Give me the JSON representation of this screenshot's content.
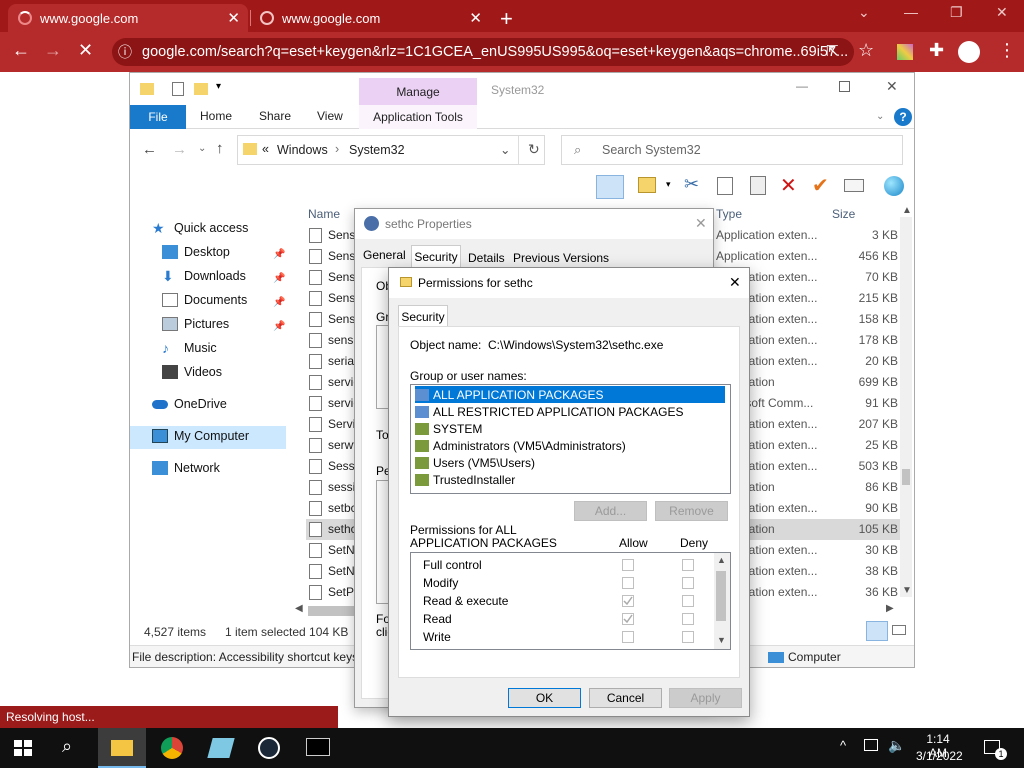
{
  "browser": {
    "tabs": [
      {
        "label": "www.google.com"
      },
      {
        "label": "www.google.com"
      }
    ],
    "url": "google.com/search?q=eset+keygen&rlz=1C1GCEA_enUS995US995&oq=eset+keygen&aqs=chrome..69i57..."
  },
  "explorer": {
    "title": "System32",
    "ribbon": {
      "file": "File",
      "home": "Home",
      "share": "Share",
      "view": "View",
      "manage": "Manage",
      "app_tools": "Application Tools"
    },
    "breadcrumb": {
      "prefix": "«",
      "parent": "Windows",
      "current": "System32"
    },
    "search_placeholder": "Search System32",
    "nav": [
      {
        "label": "Quick access"
      },
      {
        "label": "Desktop"
      },
      {
        "label": "Downloads"
      },
      {
        "label": "Documents"
      },
      {
        "label": "Pictures"
      },
      {
        "label": "Music"
      },
      {
        "label": "Videos"
      },
      {
        "label": "OneDrive"
      },
      {
        "label": "My Computer"
      },
      {
        "label": "Network"
      }
    ],
    "columns": {
      "name": "Name",
      "type": "Type",
      "size": "Size"
    },
    "files": [
      {
        "name": "Sensor",
        "type": "Application exten...",
        "size": "3 KB"
      },
      {
        "name": "Sensor",
        "type": "Application exten...",
        "size": "456 KB"
      },
      {
        "name": "Sensor",
        "type": "Application exten...",
        "size": "70 KB"
      },
      {
        "name": "Sensor",
        "type": "Application exten...",
        "size": "215 KB"
      },
      {
        "name": "Sensor",
        "type": "Application exten...",
        "size": "158 KB"
      },
      {
        "name": "sensrs",
        "type": "Application exten...",
        "size": "178 KB"
      },
      {
        "name": "serial",
        "type": "Application exten...",
        "size": "20 KB"
      },
      {
        "name": "servic",
        "type": "Application",
        "size": "699 KB"
      },
      {
        "name": "servic",
        "type": "Microsoft Comm...",
        "size": "91 KB"
      },
      {
        "name": "Servic",
        "type": "Application exten...",
        "size": "207 KB"
      },
      {
        "name": "serwv",
        "type": "Application exten...",
        "size": "25 KB"
      },
      {
        "name": "SessE",
        "type": "Application exten...",
        "size": "503 KB"
      },
      {
        "name": "sessio",
        "type": "Application",
        "size": "86 KB"
      },
      {
        "name": "setbc",
        "type": "Application exten...",
        "size": "90 KB"
      },
      {
        "name": "sethc",
        "type": "Application",
        "size": "105 KB"
      },
      {
        "name": "SetNe",
        "type": "Application exten...",
        "size": "30 KB"
      },
      {
        "name": "SetNe",
        "type": "Application exten...",
        "size": "38 KB"
      },
      {
        "name": "SetPr",
        "type": "Application exten...",
        "size": "36 KB"
      }
    ],
    "status": {
      "items": "4,527 items",
      "selected": "1 item selected  104 KB"
    },
    "details_bar": {
      "description": "File description: Accessibility shortcut keys",
      "location": "Computer"
    }
  },
  "props_dialog": {
    "title": "sethc Properties",
    "tabs": [
      "General",
      "Security",
      "Details",
      "Previous Versions"
    ],
    "snippets": {
      "ob": "Ob",
      "gr": "Gr",
      "to": "To",
      "pe": "Pe",
      "fo": "Fo",
      "cli": "clic"
    }
  },
  "perm_dialog": {
    "title": "Permissions for sethc",
    "tab": "Security",
    "object_label": "Object name:",
    "object_value": "C:\\Windows\\System32\\sethc.exe",
    "group_label": "Group or user names:",
    "users": [
      {
        "name": "ALL APPLICATION PACKAGES",
        "selected": true
      },
      {
        "name": "ALL RESTRICTED APPLICATION PACKAGES"
      },
      {
        "name": "SYSTEM"
      },
      {
        "name": "Administrators (VM5\\Administrators)"
      },
      {
        "name": "Users (VM5\\Users)"
      },
      {
        "name": "TrustedInstaller"
      }
    ],
    "add": "Add...",
    "remove": "Remove",
    "perm_label_1": "Permissions for ALL",
    "perm_label_2": "APPLICATION PACKAGES",
    "allow": "Allow",
    "deny": "Deny",
    "permissions": [
      {
        "name": "Full control",
        "allow": false,
        "deny": false
      },
      {
        "name": "Modify",
        "allow": false,
        "deny": false
      },
      {
        "name": "Read & execute",
        "allow": true,
        "deny": false
      },
      {
        "name": "Read",
        "allow": true,
        "deny": false
      },
      {
        "name": "Write",
        "allow": false,
        "deny": false
      }
    ],
    "ok": "OK",
    "cancel": "Cancel",
    "apply": "Apply"
  },
  "browser_status": "Resolving host...",
  "taskbar": {
    "time": "1:14 AM",
    "date": "3/1/2022",
    "notif_count": "1"
  },
  "colors": {
    "chrome": "#a01818",
    "selection": "#0078d7",
    "ribbon_file": "#1979ca"
  }
}
